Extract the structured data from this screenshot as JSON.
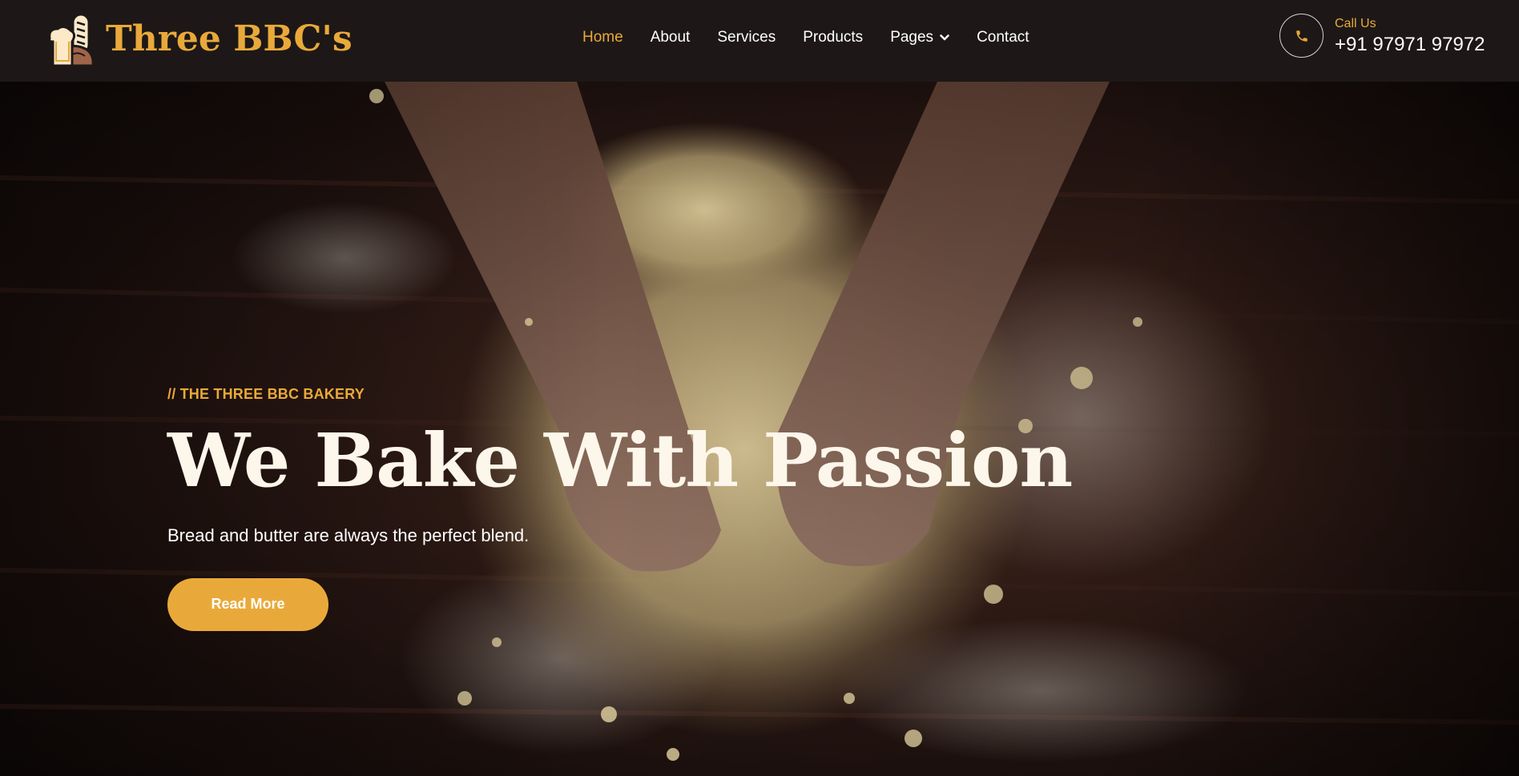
{
  "brand": {
    "name": "Three BBC's",
    "logo_icon": "bread-baguette-logo-icon",
    "accent_color": "#e9a93a"
  },
  "nav": {
    "items": [
      {
        "label": "Home",
        "active": true
      },
      {
        "label": "About"
      },
      {
        "label": "Services"
      },
      {
        "label": "Products"
      },
      {
        "label": "Pages",
        "dropdown": true
      },
      {
        "label": "Contact"
      }
    ]
  },
  "contact": {
    "icon": "phone-icon",
    "label": "Call Us",
    "number": "+91 97971 97972"
  },
  "hero": {
    "eyebrow": "// THE THREE BBC BAKERY",
    "title": "We Bake With Passion",
    "subtitle": "Bread and butter are always the perfect blend.",
    "cta_label": "Read More",
    "background": "hands-kneading-dough-photo"
  }
}
